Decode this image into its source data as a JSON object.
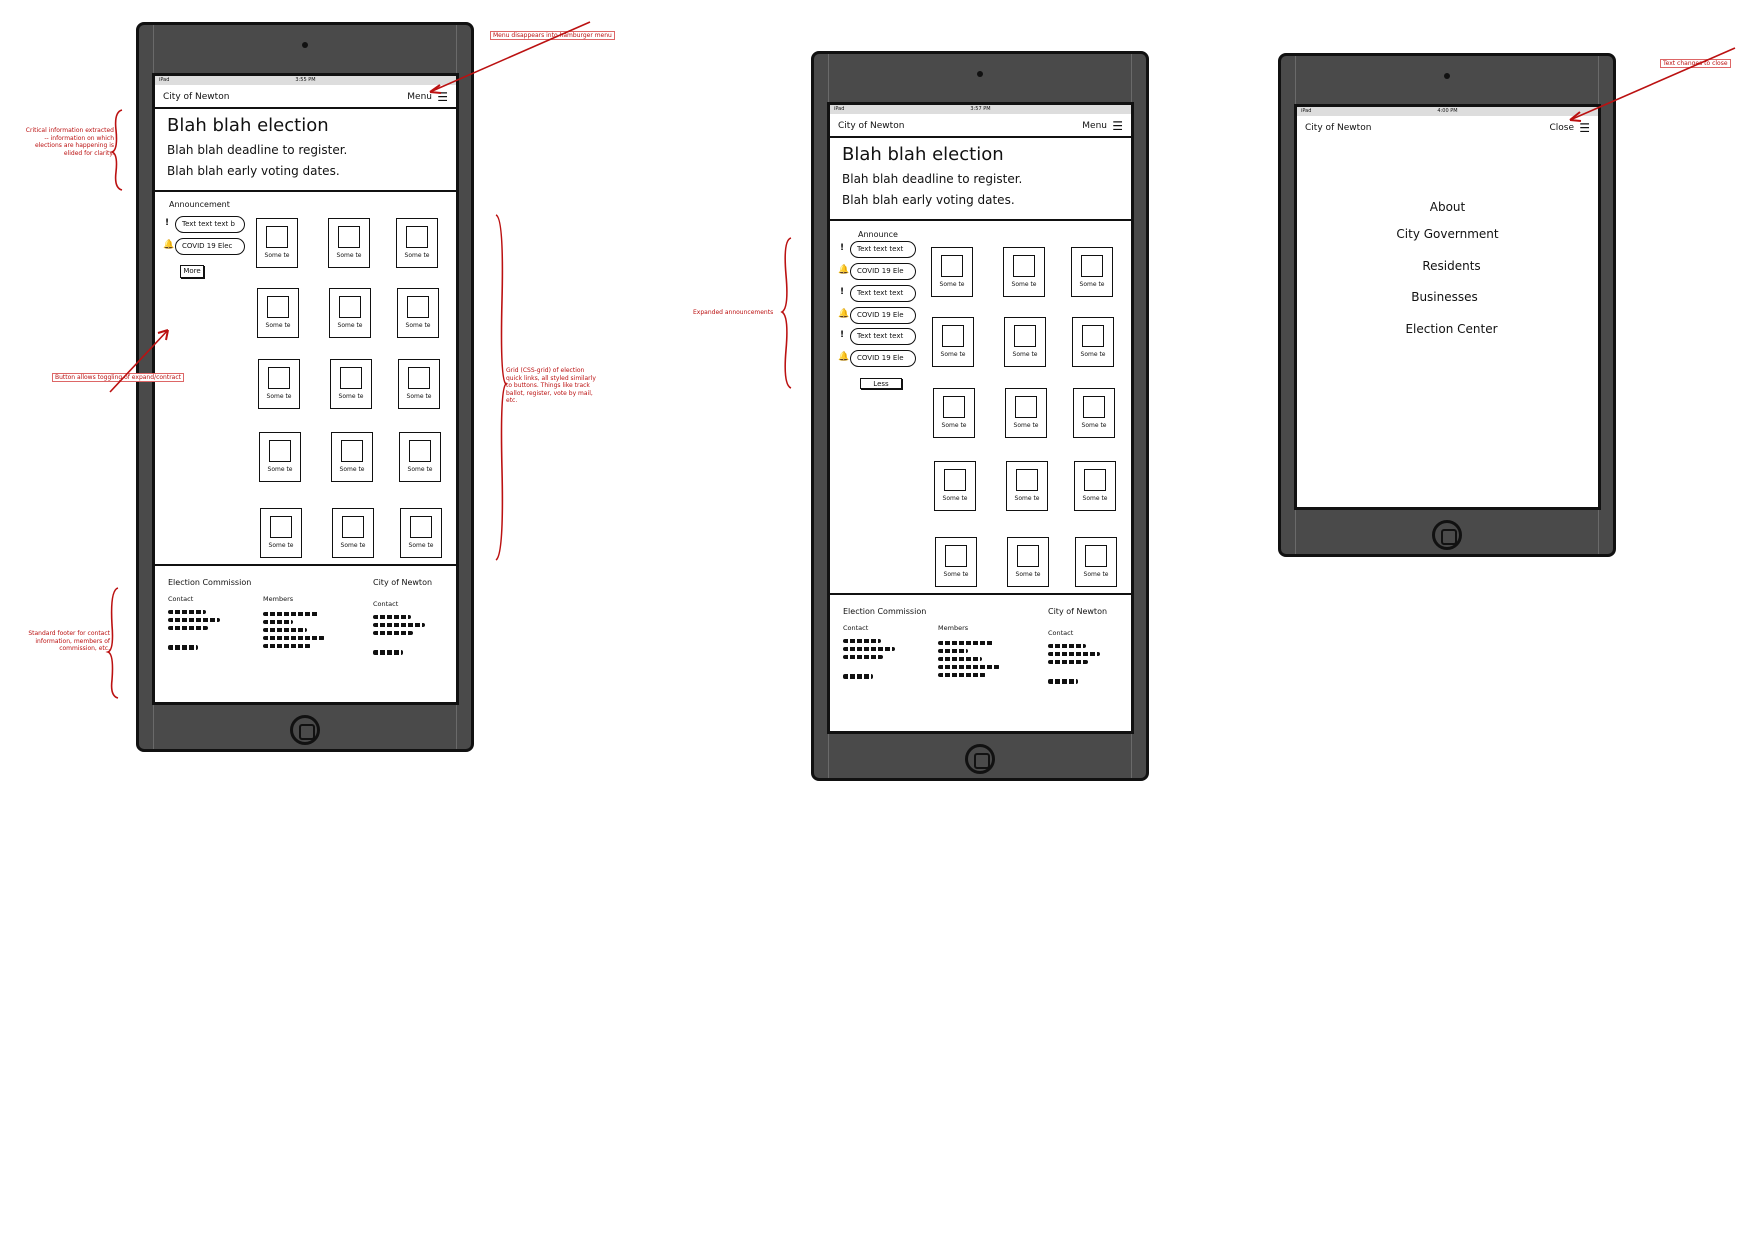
{
  "ipad_status": {
    "carrier": "iPad"
  },
  "frame1": {
    "time": "3:55 PM",
    "site": "City of Newton",
    "menu_label": "Menu",
    "hero_title": "Blah blah election",
    "hero_line1": "Blah blah deadline to register.",
    "hero_line2": "Blah blah early voting dates.",
    "announcements_title": "Announcement",
    "announcements": [
      {
        "icon": "!",
        "text": "Text text text b"
      },
      {
        "icon": "bell",
        "text": "COVID 19 Elec"
      }
    ],
    "more_label": "More",
    "tile_label": "Some te"
  },
  "frame2": {
    "time": "3:57 PM",
    "site": "City of Newton",
    "menu_label": "Menu",
    "hero_title": "Blah blah election",
    "hero_line1": "Blah blah deadline to register.",
    "hero_line2": "Blah blah early voting dates.",
    "announcements_title": "Announce",
    "announcements": [
      {
        "icon": "!",
        "text": "Text text text"
      },
      {
        "icon": "bell",
        "text": "COVID 19 Ele"
      },
      {
        "icon": "!",
        "text": "Text text text"
      },
      {
        "icon": "bell",
        "text": "COVID 19 Ele"
      },
      {
        "icon": "!",
        "text": "Text text text"
      },
      {
        "icon": "bell",
        "text": "COVID 19 Ele"
      }
    ],
    "less_label": "Less",
    "tile_label": "Some te"
  },
  "frame3": {
    "time": "4:00 PM",
    "site": "City of Newton",
    "close_label": "Close",
    "menu_items": [
      "About",
      "City Government",
      "Residents",
      "Businesses",
      "Election Center"
    ]
  },
  "footer": {
    "commission_title": "Election Commission",
    "contact_label": "Contact",
    "members_label": "Members",
    "city_title": "City of Newton",
    "city_contact_label": "Contact"
  },
  "annotations": {
    "hamburger": "Menu disappears into hamburger menu",
    "critical": "Critical information extracted -- information on which elections are happening is elided for clarity.",
    "toggle": "Button allows toggling of expand/contract",
    "grid": "Grid (CSS-grid) of election quick links, all styled similarly to buttons. Things like track ballot, register, vote by mail, etc.",
    "footer": "Standard footer for contact information, members of commission, etc.",
    "expanded": "Expanded announcements",
    "close": "Text changes to close"
  },
  "colors": {
    "device": "#4a4a4a",
    "annotation": "#bb1111"
  }
}
